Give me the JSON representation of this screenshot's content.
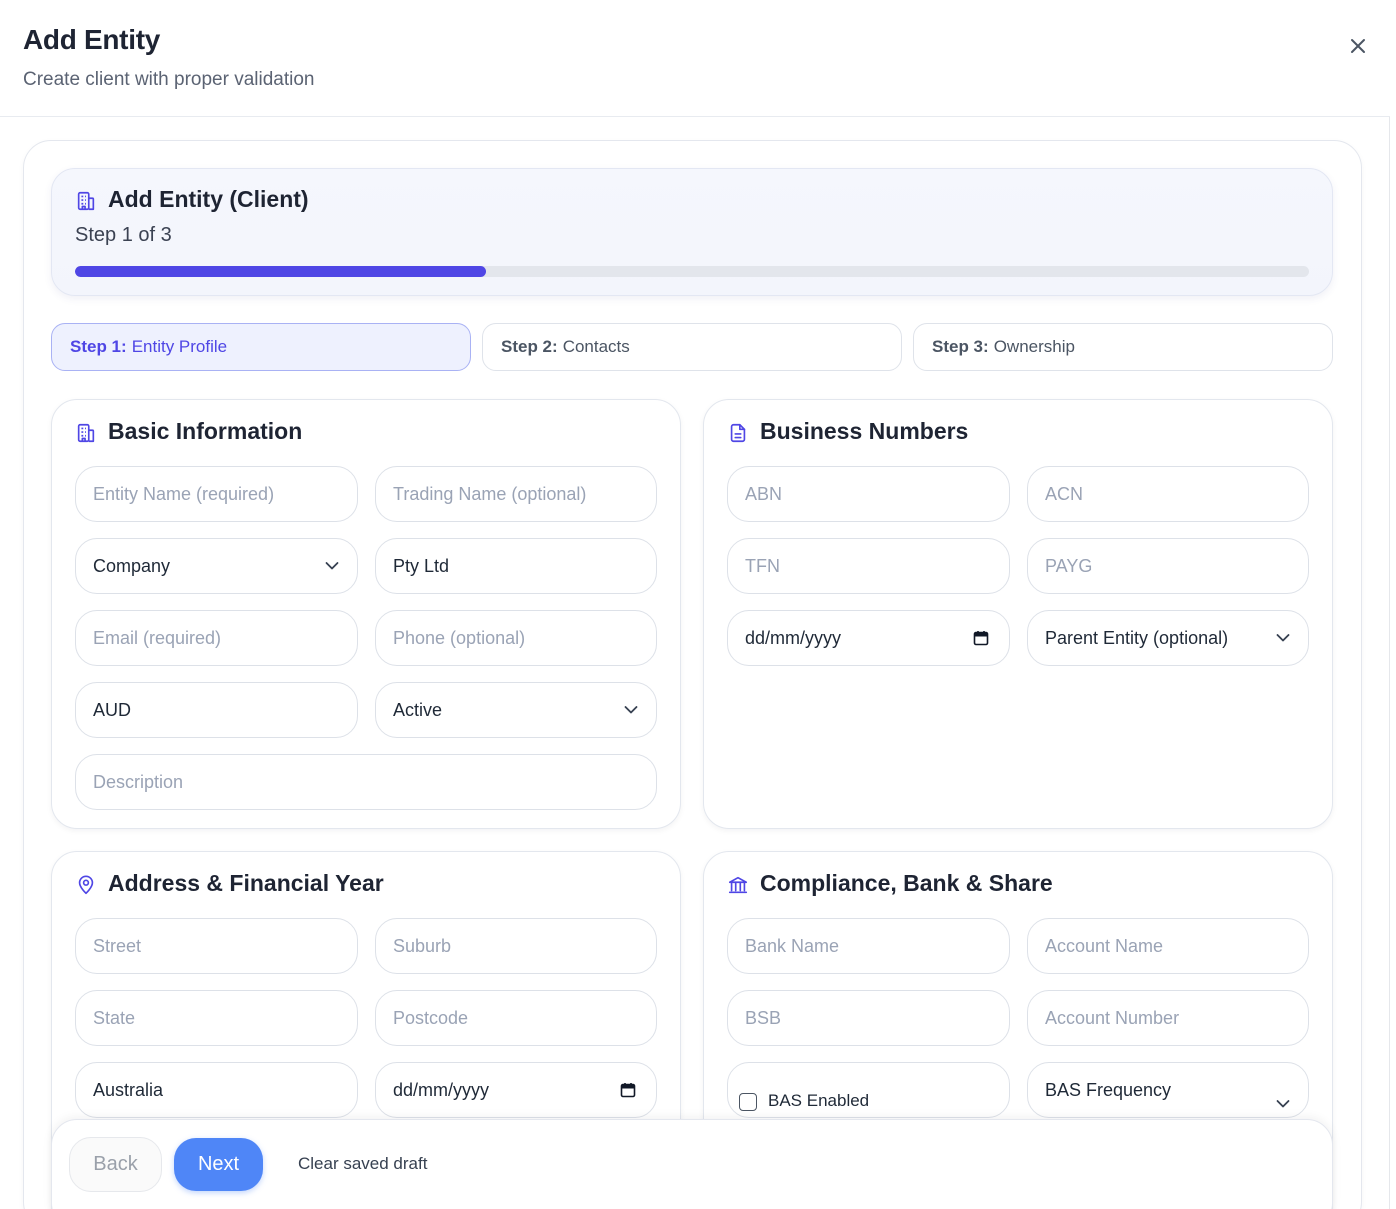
{
  "modal": {
    "title": "Add Entity",
    "subtitle": "Create client with proper validation"
  },
  "wizard": {
    "title": "Add Entity (Client)",
    "step_text": "Step 1 of 3",
    "progress_fraction": 0.333
  },
  "steps": [
    {
      "prefix": "Step 1:",
      "label": "Entity Profile",
      "active": true
    },
    {
      "prefix": "Step 2:",
      "label": "Contacts",
      "active": false
    },
    {
      "prefix": "Step 3:",
      "label": "Ownership",
      "active": false
    }
  ],
  "basic": {
    "title": "Basic Information",
    "entity_name_placeholder": "Entity Name (required)",
    "trading_name_placeholder": "Trading Name (optional)",
    "entity_type_value": "Company",
    "entity_suffix_value": "Pty Ltd",
    "email_placeholder": "Email (required)",
    "phone_placeholder": "Phone (optional)",
    "currency_value": "AUD",
    "status_value": "Active",
    "description_placeholder": "Description"
  },
  "business": {
    "title": "Business Numbers",
    "abn_placeholder": "ABN",
    "acn_placeholder": "ACN",
    "tfn_placeholder": "TFN",
    "payg_placeholder": "PAYG",
    "date_placeholder": "dd/mm/yyyy",
    "parent_entity_value": "Parent Entity (optional)"
  },
  "address": {
    "title": "Address & Financial Year",
    "street_placeholder": "Street",
    "suburb_placeholder": "Suburb",
    "state_placeholder": "State",
    "postcode_placeholder": "Postcode",
    "country_value": "Australia",
    "date_placeholder": "dd/mm/yyyy"
  },
  "compliance": {
    "title": "Compliance, Bank & Share",
    "bank_name_placeholder": "Bank Name",
    "account_name_placeholder": "Account Name",
    "bsb_placeholder": "BSB",
    "account_number_placeholder": "Account Number",
    "bas_enabled_label": "BAS Enabled",
    "bas_frequency_value": "BAS Frequency"
  },
  "footer": {
    "back_label": "Back",
    "next_label": "Next",
    "clear_label": "Clear saved draft"
  },
  "colors": {
    "accent": "#4f46e5",
    "primary_button": "#4f86f7"
  },
  "icons": {
    "close": "close-icon",
    "wizard": "building-icon",
    "basic": "building-icon",
    "business": "document-icon",
    "address": "map-pin-icon",
    "compliance": "bank-icon"
  }
}
